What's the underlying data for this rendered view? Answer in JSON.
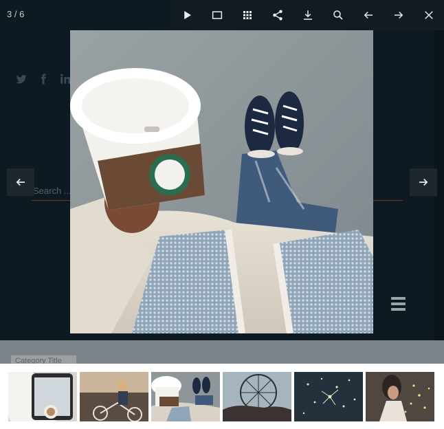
{
  "lightbox": {
    "counter": "3 / 6",
    "toolbar": [
      {
        "name": "slideshow-play-button",
        "icon": "play-icon"
      },
      {
        "name": "fullscreen-button",
        "icon": "fullscreen-icon"
      },
      {
        "name": "thumbnails-button",
        "icon": "grid-icon"
      },
      {
        "name": "share-button",
        "icon": "share-icon"
      },
      {
        "name": "download-button",
        "icon": "download-icon"
      },
      {
        "name": "zoom-button",
        "icon": "zoom-icon"
      },
      {
        "name": "toolbar-prev-button",
        "icon": "arrow-left-icon"
      },
      {
        "name": "toolbar-next-button",
        "icon": "arrow-right-icon"
      },
      {
        "name": "close-button",
        "icon": "close-icon"
      }
    ],
    "current_index": 3,
    "total": 6,
    "thumbnails": [
      {
        "name": "thumbnail-1",
        "subject": "phone-coffee"
      },
      {
        "name": "thumbnail-2",
        "subject": "woman-bicycle"
      },
      {
        "name": "thumbnail-3",
        "subject": "coffee-sneakers",
        "active": true
      },
      {
        "name": "thumbnail-4",
        "subject": "ferris-wheel"
      },
      {
        "name": "thumbnail-5",
        "subject": "sparkler-lights"
      },
      {
        "name": "thumbnail-6",
        "subject": "woman-fairy-lights"
      }
    ]
  },
  "background_page": {
    "search_placeholder": "Search ...",
    "chip_text": "Category Title",
    "social_icons": [
      "twitter-icon",
      "facebook-icon",
      "linkedin-icon"
    ]
  },
  "colors": {
    "toolbar_bg": "#121b21",
    "icon": "#e8ecef",
    "strip_bg": "#ffffff",
    "search_underline": "#7a2b2b"
  }
}
